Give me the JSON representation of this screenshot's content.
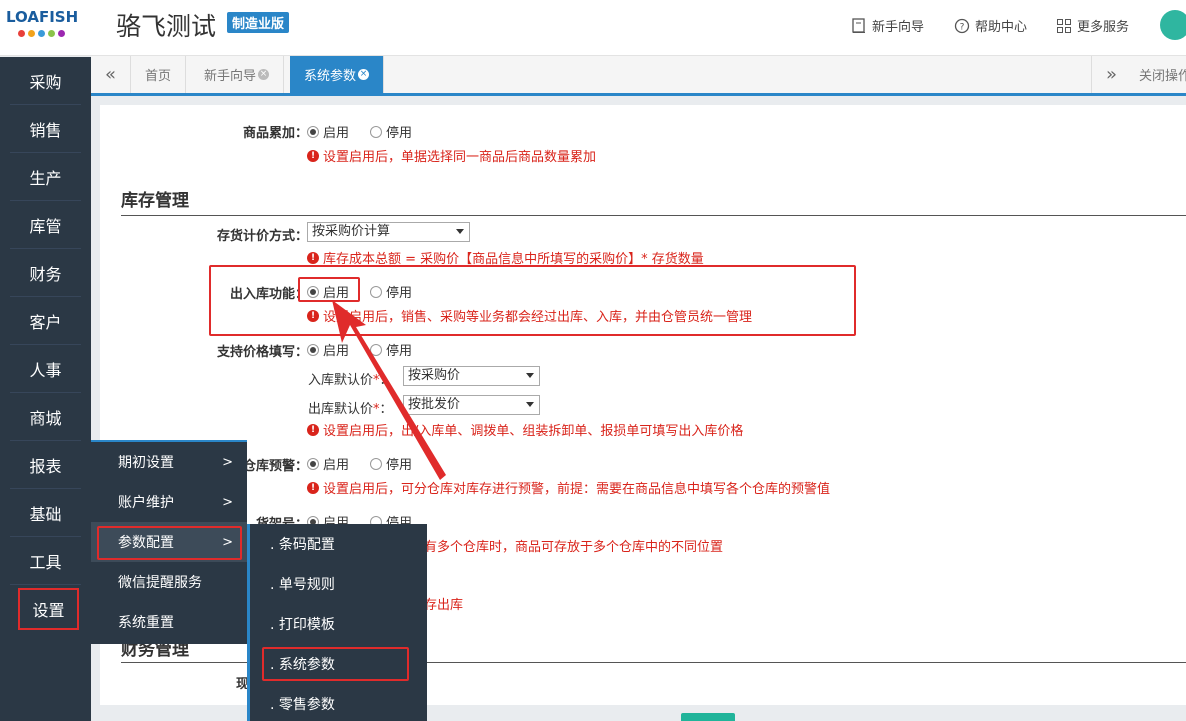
{
  "header": {
    "title": "骆飞测试",
    "edition": "制造业版",
    "links": [
      {
        "label": "新手向导",
        "icon": "guide-icon"
      },
      {
        "label": "帮助中心",
        "icon": "help-icon"
      },
      {
        "label": "更多服务",
        "icon": "grid-icon"
      }
    ]
  },
  "logo": {
    "text": "LOAFISH",
    "dot_colors": [
      "#e8403a",
      "#f2a21b",
      "#3a9ad9",
      "#8bc34a",
      "#9c27b0"
    ]
  },
  "sidebar": {
    "items": [
      "采购",
      "销售",
      "生产",
      "库管",
      "财务",
      "客户",
      "人事",
      "商城",
      "报表",
      "基础",
      "工具",
      "设置"
    ]
  },
  "tabs": {
    "items": [
      {
        "label": "首页",
        "closable": false
      },
      {
        "label": "新手向导",
        "closable": true
      },
      {
        "label": "系统参数",
        "closable": true,
        "active": true
      }
    ],
    "close_ops": "关闭操作"
  },
  "content": {
    "goods_accumulate": {
      "label": "商品累加：",
      "on": "启用",
      "off": "停用",
      "hint": "设置启用后，单据选择同一商品后商品数量累加"
    },
    "inventory_section": "库存管理",
    "cost_method": {
      "label": "存货计价方式：",
      "value": "按采购价计算",
      "hint": "库存成本总额 = 采购价【商品信息中所填写的采购价】* 存货数量"
    },
    "in_out": {
      "label": "出入库功能：",
      "on": "启用",
      "off": "停用",
      "hint": "设置启用后，销售、采购等业务都会经过出库、入库，并由仓管员统一管理"
    },
    "price_fill": {
      "label": "支持价格填写：",
      "on": "启用",
      "off": "停用",
      "in_label": "入库默认价",
      "in_value": "按采购价",
      "out_label": "出库默认价",
      "out_value": "按批发价",
      "req": "*",
      "colon": "：",
      "hint": "设置启用后，出/入库单、调拨单、组装拆卸单、报损单可填写出入库价格"
    },
    "warehouse_alert": {
      "label": "仓库预警：",
      "on": "启用",
      "off": "停用",
      "hint": "设置启用后，可分仓库对库存进行预警，前提：需要在商品信息中填写各个仓库的预警值"
    },
    "shelf": {
      "label": "货架号：",
      "on": "启用",
      "off": "停用",
      "hint_tail": "有多个仓库时，商品可存放于多个仓库中的不同位置"
    },
    "neg_stock_tail": "存出库",
    "finance_section": "财务管理",
    "cash_label_head": "现"
  },
  "menu_level1": [
    "期初设置",
    "账户维护",
    "参数配置",
    "微信提醒服务",
    "系统重置"
  ],
  "menu_level2": [
    ". 条码配置",
    ". 单号规则",
    ". 打印模板",
    ". 系统参数",
    ". 零售参数"
  ],
  "arrow_glyph": ">"
}
